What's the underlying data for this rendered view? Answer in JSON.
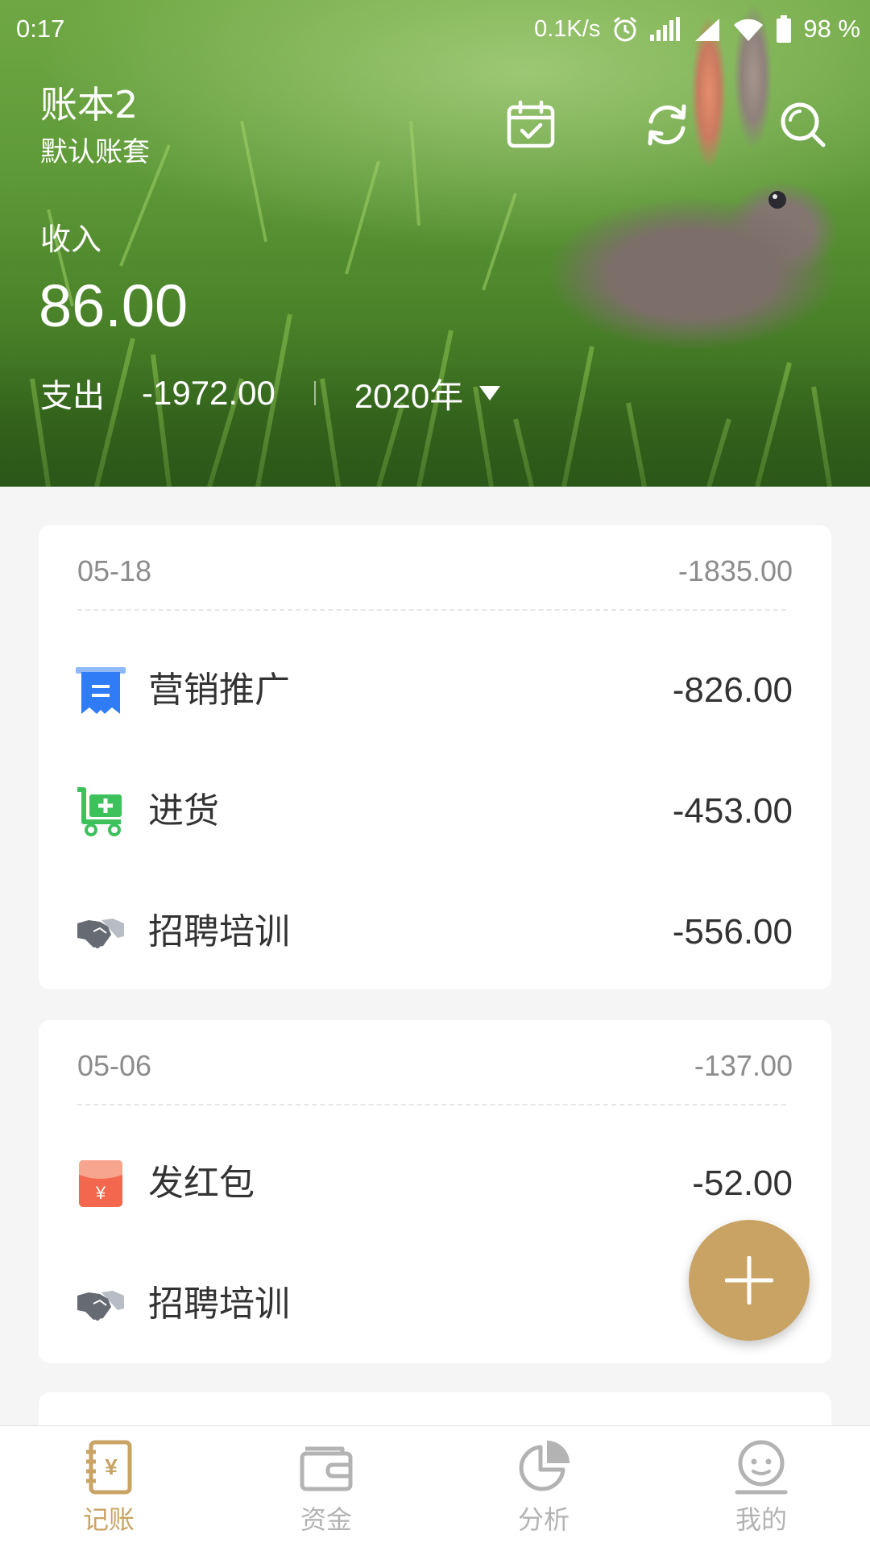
{
  "status_bar": {
    "time": "0:17",
    "net_speed": "0.1K/s",
    "battery": "98 %",
    "icons": [
      "alarm-icon",
      "signal-bars-icon",
      "cell-signal-icon",
      "wifi-icon",
      "battery-icon"
    ]
  },
  "header": {
    "book_name": "账本2",
    "book_set": "默认账套",
    "actions": [
      "calendar-icon",
      "sync-icon",
      "search-icon"
    ],
    "income_label": "收入",
    "income_amount": "86.00",
    "expense_label": "支出",
    "expense_amount": "-1972.00",
    "year": "2020年"
  },
  "groups": [
    {
      "date": "05-18",
      "total": "-1835.00",
      "items": [
        {
          "icon": "receipt-icon",
          "label": "营销推广",
          "amount": "-826.00"
        },
        {
          "icon": "cart-icon",
          "label": "进货",
          "amount": "-453.00"
        },
        {
          "icon": "handshake-icon",
          "label": "招聘培训",
          "amount": "-556.00"
        }
      ]
    },
    {
      "date": "05-06",
      "total": "-137.00",
      "items": [
        {
          "icon": "red-envelope-icon",
          "label": "发红包",
          "amount": "-52.00"
        },
        {
          "icon": "handshake-icon",
          "label": "招聘培训",
          "amount": ""
        }
      ]
    }
  ],
  "fab": {
    "icon": "plus-icon"
  },
  "tabs": [
    {
      "label": "记账",
      "icon": "ledger-icon",
      "active": true
    },
    {
      "label": "资金",
      "icon": "wallet-icon",
      "active": false
    },
    {
      "label": "分析",
      "icon": "pie-chart-icon",
      "active": false
    },
    {
      "label": "我的",
      "icon": "smiley-icon",
      "active": false
    }
  ],
  "colors": {
    "accent": "#c9a364",
    "inactive": "#b3b3b3",
    "receipt": "#2f7cf6",
    "cart": "#3cc15b",
    "handshake": "#666a73",
    "red_envelope": "#f2674d"
  }
}
